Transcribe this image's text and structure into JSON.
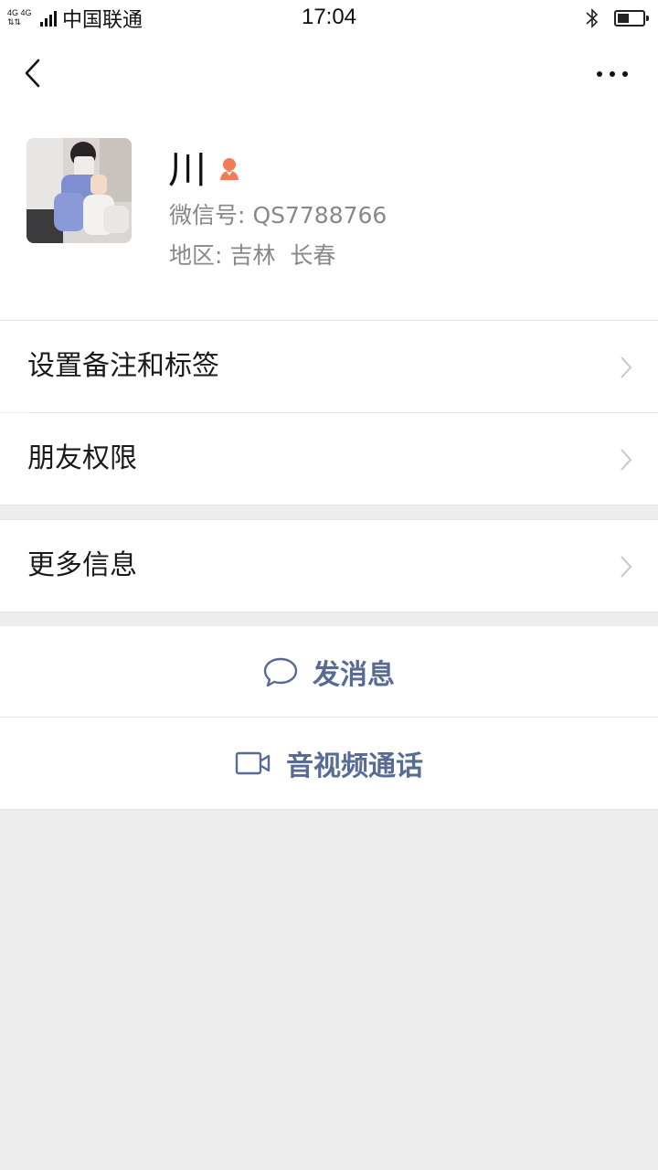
{
  "status_bar": {
    "network": "4G 4G",
    "carrier": "中国联通",
    "time": "17:04",
    "battery_level": 0.45,
    "icons": [
      "signal-icon",
      "bluetooth-icon",
      "battery-icon"
    ]
  },
  "nav": {
    "back_icon": "chevron-left-icon",
    "more_icon": "ellipsis-icon"
  },
  "profile": {
    "name": "川",
    "gender_icon": "female-icon",
    "wechat_id_label": "微信号:",
    "wechat_id": "QS7788766",
    "region_label": "地区:",
    "region": "吉林  长春"
  },
  "menu": {
    "remark_tags": "设置备注和标签",
    "friend_permissions": "朋友权限",
    "more_info": "更多信息"
  },
  "actions": {
    "send_message": "发消息",
    "av_call": "音视频通话"
  },
  "colors": {
    "accent_link": "#576b95",
    "female_icon": "#f37b56",
    "background": "#ededed"
  }
}
